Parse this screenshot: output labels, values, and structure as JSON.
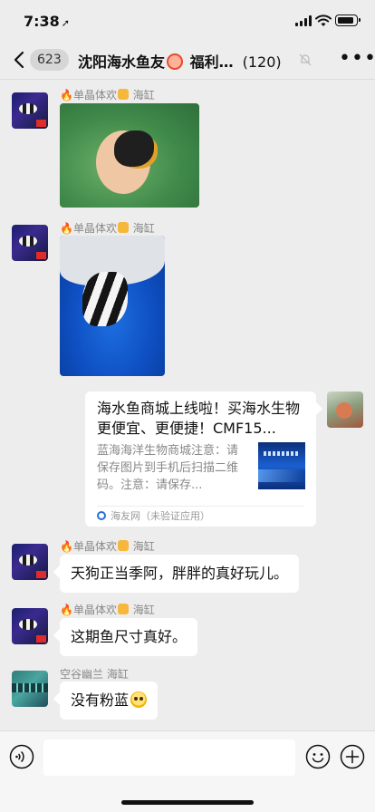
{
  "status_bar": {
    "time": "7:38",
    "location_glyph": "➚"
  },
  "nav": {
    "unread_count": "623",
    "title_part1": "沈阳海水鱼友",
    "title_part2": "福利…",
    "member_count": "(120)"
  },
  "messages": [
    {
      "sender": "单晶体欢",
      "sender_suffix": "海缸",
      "type": "image",
      "image": "fish-in-hand-green-tank"
    },
    {
      "sender": "单晶体欢",
      "sender_suffix": "海缸",
      "type": "image",
      "image": "fish-in-hand-blue-tank"
    },
    {
      "type": "link-card",
      "mine": true,
      "title": "海水鱼商城上线啦！买海水生物更便宜、更便捷！CMF15...",
      "description": "蓝海海洋生物商城注意：请保存图片到手机后扫描二维码。注意：请保存...",
      "source": "海友网（未验证应用）"
    },
    {
      "sender": "单晶体欢",
      "sender_suffix": "海缸",
      "type": "text",
      "text": "天狗正当季阿，胖胖的真好玩儿。"
    },
    {
      "sender": "单晶体欢",
      "sender_suffix": "海缸",
      "type": "text",
      "text": "这期鱼尺寸真好。"
    },
    {
      "sender": "空谷幽兰 海缸",
      "type": "text",
      "text": "没有粉蓝"
    }
  ],
  "input": {
    "placeholder": ""
  },
  "colors": {
    "background": "#ededed",
    "bubble": "#ffffff",
    "accent_flame": "#ff6a00"
  }
}
